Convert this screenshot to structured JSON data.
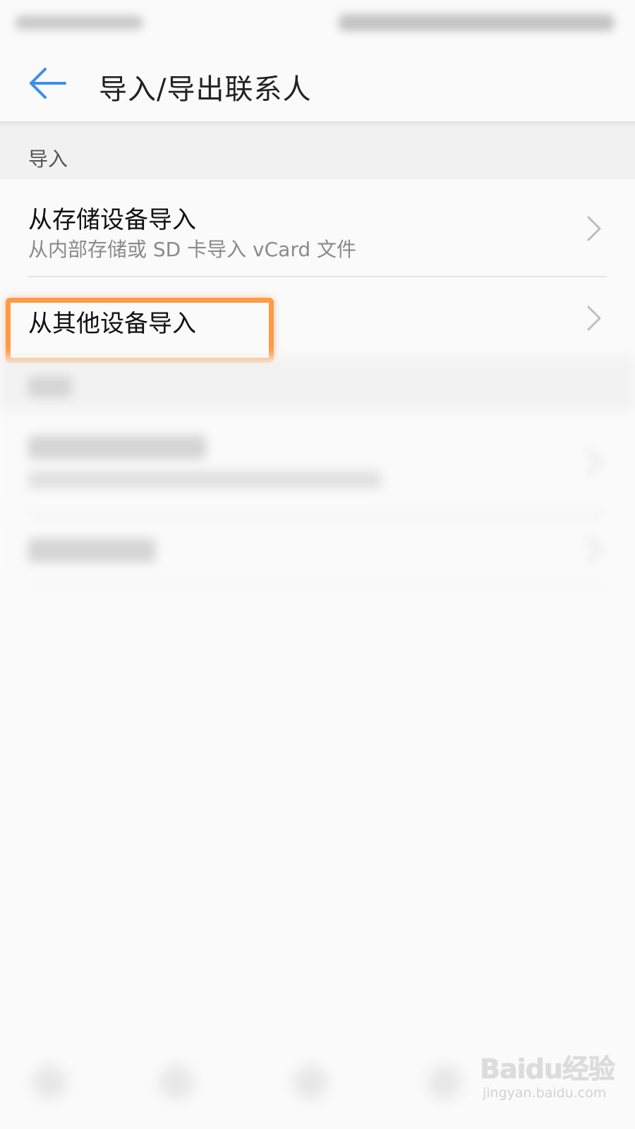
{
  "header": {
    "title": "导入/导出联系人",
    "back_icon": "arrow-left-icon",
    "accent_color": "#3d8ee8"
  },
  "import_section": {
    "label": "导入",
    "items": [
      {
        "title": "从存储设备导入",
        "subtitle": "从内部存储或 SD 卡导入 vCard 文件",
        "icon": "chevron-right-icon"
      },
      {
        "title": "从其他设备导入",
        "icon": "chevron-right-icon"
      }
    ]
  },
  "annotation": {
    "highlight_color": "#ff9a45"
  },
  "watermark": {
    "logo": "Baidu经验",
    "url": "jingyan.baidu.com"
  }
}
